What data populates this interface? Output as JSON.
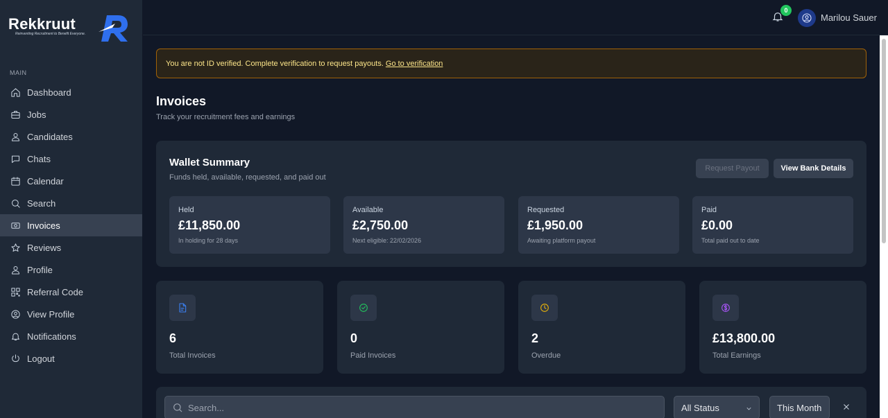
{
  "brand": {
    "name": "Rekkruut",
    "tagline": "Reinventing Recruitment to Benefit Everyone.",
    "accent": "#2f6fed"
  },
  "sidebar": {
    "section_label": "MAIN",
    "items": [
      {
        "label": "Dashboard",
        "icon": "home-icon",
        "active": false
      },
      {
        "label": "Jobs",
        "icon": "briefcase-icon",
        "active": false
      },
      {
        "label": "Candidates",
        "icon": "user-icon",
        "active": false
      },
      {
        "label": "Chats",
        "icon": "chat-icon",
        "active": false
      },
      {
        "label": "Calendar",
        "icon": "calendar-icon",
        "active": false
      },
      {
        "label": "Search",
        "icon": "search-icon",
        "active": false
      },
      {
        "label": "Invoices",
        "icon": "invoice-icon",
        "active": true
      },
      {
        "label": "Reviews",
        "icon": "star-icon",
        "active": false
      },
      {
        "label": "Profile",
        "icon": "user-icon",
        "active": false
      },
      {
        "label": "Referral Code",
        "icon": "qr-code-icon",
        "active": false
      },
      {
        "label": "View Profile",
        "icon": "user-circle-icon",
        "active": false
      },
      {
        "label": "Notifications",
        "icon": "bell-icon",
        "active": false
      },
      {
        "label": "Logout",
        "icon": "logout-icon",
        "active": false
      }
    ]
  },
  "header": {
    "notification_count": "0",
    "user_name": "Marilou Sauer"
  },
  "alert": {
    "message": "You are not ID verified. Complete verification to request payouts.",
    "link": "Go to verification"
  },
  "page": {
    "title": "Invoices",
    "subtitle": "Track your recruitment fees and earnings"
  },
  "wallet": {
    "title": "Wallet Summary",
    "subtitle": "Funds held, available, requested, and paid out",
    "request_payout": "Request Payout",
    "view_bank": "View Bank Details",
    "cards": [
      {
        "label": "Held",
        "value": "£11,850.00",
        "note": "In holding for 28 days"
      },
      {
        "label": "Available",
        "value": "£2,750.00",
        "note": "Next eligible: 22/02/2026"
      },
      {
        "label": "Requested",
        "value": "£1,950.00",
        "note": "Awaiting platform payout"
      },
      {
        "label": "Paid",
        "value": "£0.00",
        "note": "Total paid out to date"
      }
    ]
  },
  "stats": [
    {
      "value": "6",
      "label": "Total Invoices",
      "icon": "document-icon",
      "color": "#3b82f6"
    },
    {
      "value": "0",
      "label": "Paid Invoices",
      "icon": "check-circle-icon",
      "color": "#22c55e"
    },
    {
      "value": "2",
      "label": "Overdue",
      "icon": "clock-icon",
      "color": "#eab308"
    },
    {
      "value": "£13,800.00",
      "label": "Total Earnings",
      "icon": "dollar-circle-icon",
      "color": "#a855f7"
    }
  ],
  "filters": {
    "search_placeholder": "Search...",
    "status": "All Status",
    "period": "This Month"
  }
}
